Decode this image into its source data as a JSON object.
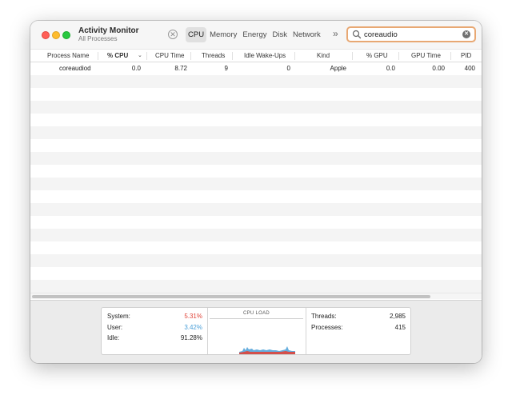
{
  "window": {
    "title": "Activity Monitor",
    "subtitle": "All Processes"
  },
  "toolbar": {
    "stop_icon": "stop-process-icon",
    "tabs": [
      {
        "label": "CPU",
        "active": true
      },
      {
        "label": "Memory",
        "active": false
      },
      {
        "label": "Disk",
        "active": false
      },
      {
        "label": "Energy",
        "active": false
      },
      {
        "label": "Network",
        "active": false
      }
    ],
    "overflow_icon": "chevron-double-right-icon",
    "overflow_glyph": "»",
    "search": {
      "value": "coreaudio",
      "placeholder": "Search",
      "icon": "search-icon",
      "clear_icon": "clear-icon"
    }
  },
  "table": {
    "columns": [
      {
        "label": "Process Name"
      },
      {
        "label": "% CPU",
        "sorted": true,
        "sort_direction": "descending"
      },
      {
        "label": "CPU Time"
      },
      {
        "label": "Threads"
      },
      {
        "label": "Idle Wake-Ups"
      },
      {
        "label": "Kind"
      },
      {
        "label": "% GPU"
      },
      {
        "label": "GPU Time"
      },
      {
        "label": "PID"
      }
    ],
    "rows": [
      {
        "process_name": "coreaudiod",
        "cpu_percent": "0.0",
        "cpu_time": "8.72",
        "threads": "9",
        "idle_wake_ups": "0",
        "kind": "Apple",
        "gpu_percent": "0.0",
        "gpu_time": "0.00",
        "pid": "400"
      }
    ]
  },
  "summary": {
    "system_label": "System:",
    "system_value": "5.31%",
    "user_label": "User:",
    "user_value": "3.42%",
    "idle_label": "Idle:",
    "idle_value": "91.28%",
    "cpu_load_title": "CPU LOAD",
    "threads_label": "Threads:",
    "threads_value": "2,985",
    "processes_label": "Processes:",
    "processes_value": "415"
  },
  "colors": {
    "system": "#e0453a",
    "user": "#4a9fd8",
    "search_focus_ring": "#e8a873",
    "row_stripe": "#f4f4f4"
  }
}
